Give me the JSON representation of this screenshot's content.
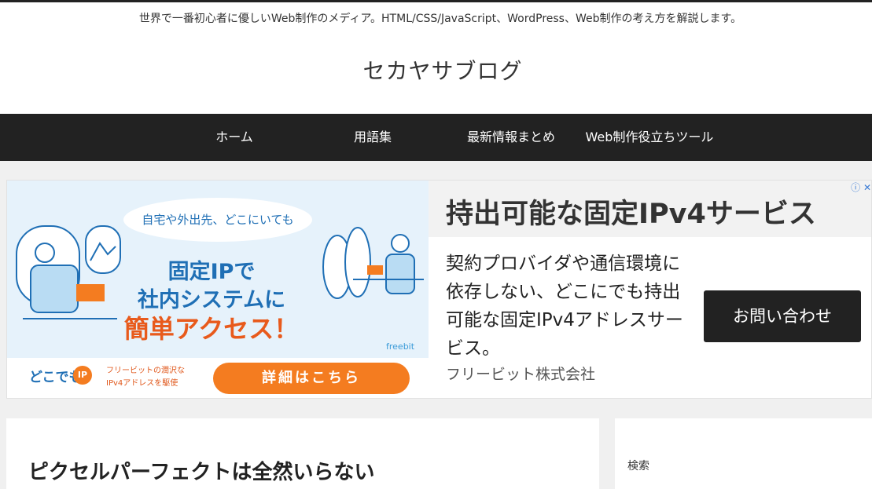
{
  "site": {
    "tagline": "世界で一番初心者に優しいWeb制作のメディア。HTML/CSS/JavaScript、WordPress、Web制作の考え方を解説します。",
    "title": "セカヤサブログ"
  },
  "nav": {
    "items": [
      {
        "label": "ホーム"
      },
      {
        "label": "用語集"
      },
      {
        "label": "最新情報まとめ"
      },
      {
        "label": "Web制作役立ちツール"
      }
    ]
  },
  "ad": {
    "banner": {
      "bubble": "自宅や外出先、どこにいても",
      "line1": "固定IPで",
      "line2": "社内システムに",
      "line3": "簡単アクセス！",
      "brand": "freebit",
      "dokodemo": "どこでも",
      "ip_badge": "IP",
      "sub_line1": "フリービットの潤沢な",
      "sub_line2": "IPv4アドレスを駆使",
      "cta": "詳細はこちら"
    },
    "headline": "持出可能な固定IPv4サービス",
    "body": "契約プロバイダや通信環境に依存しない、どこにでも持出可能な固定IPv4アドレスサービス。",
    "advertiser": "フリービット株式会社",
    "button": "お問い合わせ",
    "choices_icon": "ⓘ",
    "close_icon": "✕"
  },
  "article": {
    "title": "ピクセルパーフェクトは全然いらない"
  },
  "sidebar": {
    "search_label": "検索"
  },
  "colors": {
    "nav_bg": "#222222",
    "accent_orange": "#f47c20",
    "brand_blue": "#1f6fb5"
  }
}
